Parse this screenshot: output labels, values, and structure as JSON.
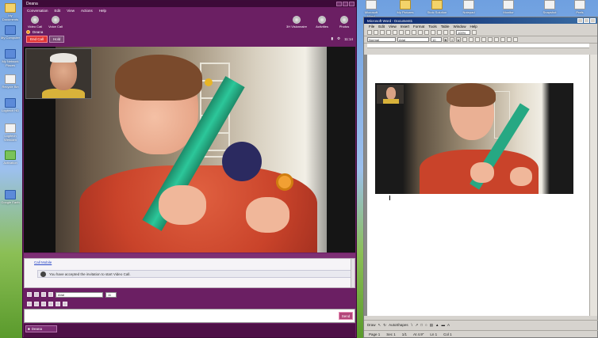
{
  "desktop": {
    "icons": [
      {
        "label": "My Documents",
        "kind": "yellow"
      },
      {
        "label": "My Computer",
        "kind": "blue"
      },
      {
        "label": "My Network Places",
        "kind": "blue"
      },
      {
        "label": "Recycle Bin",
        "kind": "white"
      },
      {
        "label": "Logitech HD",
        "kind": "blue"
      },
      {
        "label": "Logitech Webcam",
        "kind": "white"
      },
      {
        "label": "Activation",
        "kind": "green"
      },
      {
        "label": "Google Earth",
        "kind": "blue"
      }
    ],
    "top_icons": [
      {
        "label": "Microsoft Word",
        "kind": "white"
      },
      {
        "label": "My Pictures",
        "kind": "yellow"
      },
      {
        "label": "Stoic Solution",
        "kind": "yellow"
      },
      {
        "label": "Notepad",
        "kind": "white"
      },
      {
        "label": "Monitor",
        "kind": "white"
      },
      {
        "label": "Snapshot",
        "kind": "white"
      },
      {
        "label": "Prefs",
        "kind": "white"
      }
    ]
  },
  "messenger": {
    "title": "Deana",
    "menu": [
      "Conversation",
      "Edit",
      "View",
      "Actions",
      "Help"
    ],
    "toolbar_left": [
      {
        "label": "Video Call",
        "icon": "video-call-icon"
      },
      {
        "label": "Voice Call",
        "icon": "voice-call-icon"
      }
    ],
    "toolbar_right": [
      {
        "label": "3H Visionnaire",
        "icon": "contacts-icon"
      },
      {
        "label": "Activities",
        "icon": "activities-icon"
      },
      {
        "label": "Photos",
        "icon": "photos-icon"
      }
    ],
    "status_name": "Deana",
    "end_call": "End Call",
    "hold": "Hold",
    "call_time": "11:14",
    "chat_contact": "Call Mobile",
    "chat_message": "You have accepted the invitation to start Video Call.",
    "font_name": "Arial",
    "font_size": "11",
    "send": "Send",
    "bottom_contact": "Deana"
  },
  "word": {
    "title": "Microsoft Word - Document1",
    "menu": [
      "File",
      "Edit",
      "View",
      "Insert",
      "Format",
      "Tools",
      "Table",
      "Window",
      "Help"
    ],
    "zoom": "100%",
    "style": "Normal",
    "font": "Arial",
    "size": "10",
    "draw_label": "Draw",
    "autoshapes_label": "AutoShapes",
    "status": {
      "page": "Page 1",
      "sec": "Sec 1",
      "pages": "1/1",
      "at": "At 4.9\"",
      "ln": "Ln 1",
      "col": "Col 1"
    }
  }
}
